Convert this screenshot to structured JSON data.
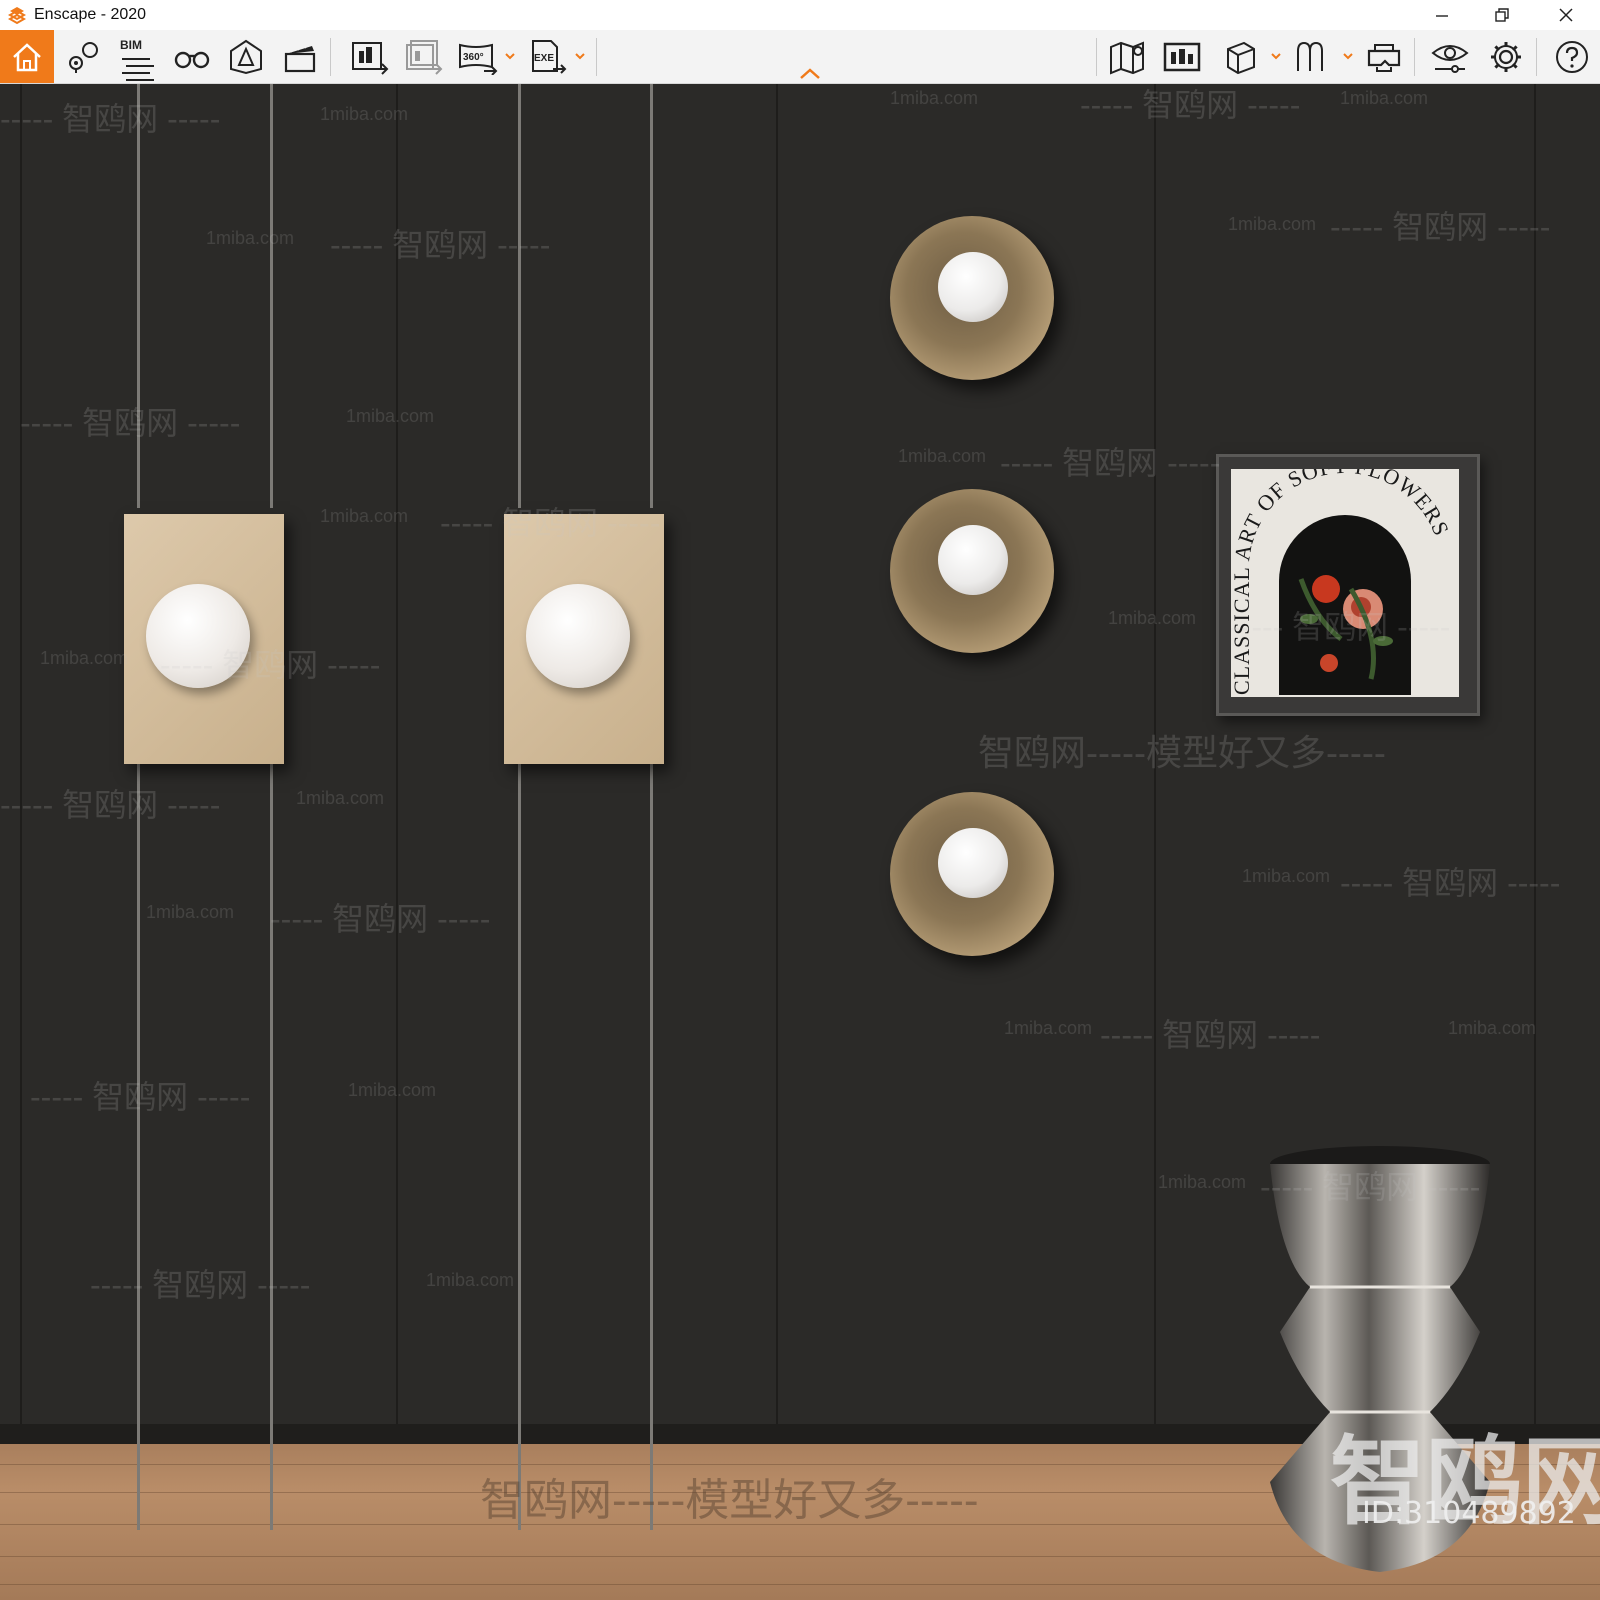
{
  "window": {
    "title": "Enscape - 2020",
    "accent": "#f07a1a"
  },
  "toolbar": {
    "bim_label": "BIM",
    "icons": [
      "home-icon",
      "location-pin-icon",
      "bim-list-icon",
      "binoculars-icon",
      "light-view-icon",
      "clapper-icon",
      "render-image-icon",
      "batch-render-icon",
      "panorama-360-icon",
      "export-exe-icon",
      "map-icon",
      "screenshot-gallery-icon",
      "cube-icon",
      "spline-icon",
      "vr-headset-icon",
      "eye-settings-icon",
      "gear-icon",
      "help-icon"
    ],
    "panorama_label": "360°",
    "exe_label": "EXE"
  },
  "artwork": {
    "poster_text": "CLASSICAL ART OF SOFT FLOWERS"
  },
  "watermarks": {
    "site": "1miba.com",
    "brand": "智鸥网",
    "slogan": "智鸥网-----模型好又多-----",
    "dash_brand": "----- 智鸥网 -----",
    "id": "ID:310489892"
  }
}
